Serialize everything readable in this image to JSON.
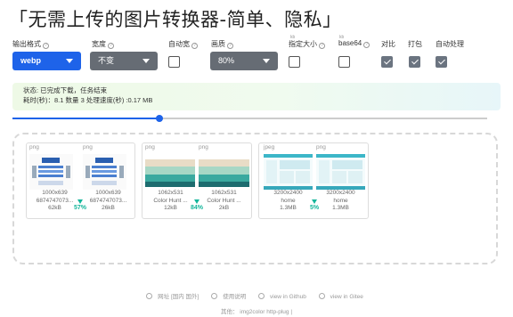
{
  "title": "「无需上传的图片转换器-简单、隐私」",
  "controls": {
    "format": {
      "label": "输出格式",
      "value": "webp"
    },
    "width": {
      "label": "宽度",
      "value": "不变"
    },
    "auto_width": {
      "label": "自动宽",
      "checked": false
    },
    "quality": {
      "label": "画质",
      "value": "80%"
    },
    "size": {
      "label": "指定大小",
      "sub": "kb",
      "checked": false
    },
    "base64": {
      "label": "base64",
      "sub": "kb",
      "checked": false
    },
    "compare": {
      "label": "对比",
      "checked": true
    },
    "pack": {
      "label": "打包",
      "checked": true
    },
    "auto": {
      "label": "自动处理",
      "checked": true
    }
  },
  "status": {
    "line1": "状态: 已完成下载，任务结束",
    "line2": "耗时(秒)：8.1 数量 3 处理速度(秒) :0.17 MB"
  },
  "slider": {
    "value_fraction": 0.31
  },
  "cards": [
    {
      "orig": {
        "type": "png",
        "dims": "1000x639",
        "name": "6874747073...",
        "size": "62kB"
      },
      "out": {
        "type": "png",
        "dims": "1000x639",
        "name": "6874747073...",
        "size": "26kB"
      },
      "pct": "57%",
      "style": "diagram"
    },
    {
      "orig": {
        "type": "png",
        "dims": "1062x531",
        "name": "Color Hunt ...",
        "size": "12kB"
      },
      "out": {
        "type": "png",
        "dims": "1062x531",
        "name": "Color Hunt ...",
        "size": "2kB"
      },
      "pct": "84%",
      "style": "palette"
    },
    {
      "orig": {
        "type": "jpeg",
        "dims": "3200x2400",
        "name": "home",
        "size": "1.3MB"
      },
      "out": {
        "type": "png",
        "dims": "3200x2400",
        "name": "home",
        "size": "1.3MB"
      },
      "pct": "5%",
      "style": "dashboard"
    }
  ],
  "footer": {
    "links": [
      "网址 [国内 国外]",
      "使用说明",
      "view in Github",
      "view in Gitee"
    ],
    "others": "其他： img2color http-plug |"
  }
}
